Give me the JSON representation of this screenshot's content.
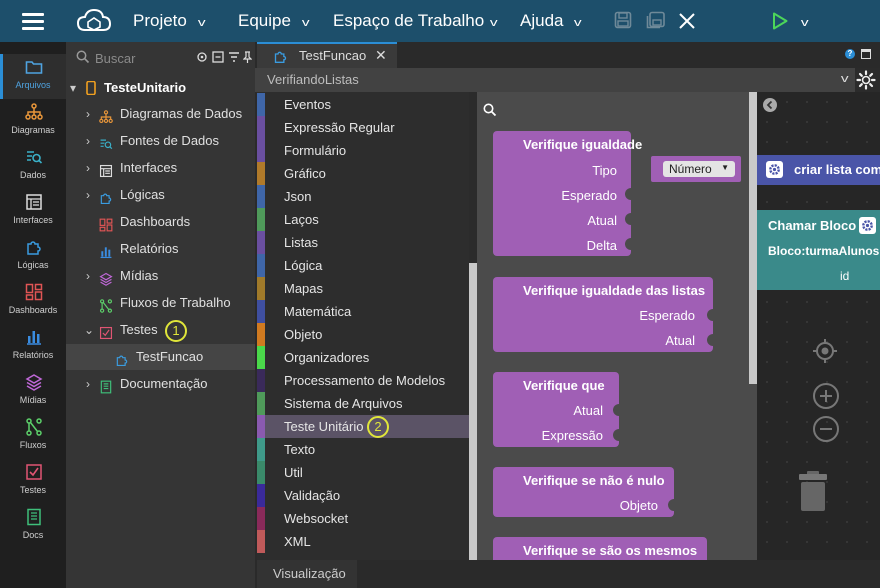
{
  "topbar": {
    "menus": [
      "Projeto",
      "Equipe",
      "Espaço de Trabalho",
      "Ajuda"
    ]
  },
  "rail": [
    {
      "label": "Arquivos",
      "icon": "folder-icon",
      "color": "#4fa3e0",
      "active": true
    },
    {
      "label": "Diagramas",
      "icon": "diagram-icon",
      "color": "#e8963a"
    },
    {
      "label": "Dados",
      "icon": "data-icon",
      "color": "#3ab0c8"
    },
    {
      "label": "Interfaces",
      "icon": "interface-icon",
      "color": "#dddddd"
    },
    {
      "label": "Lógicas",
      "icon": "puzzle-icon",
      "color": "#3a9ce0"
    },
    {
      "label": "Dashboards",
      "icon": "dashboard-icon",
      "color": "#e05555"
    },
    {
      "label": "Relatórios",
      "icon": "bar-chart-icon",
      "color": "#3a8ce0"
    },
    {
      "label": "Mídias",
      "icon": "layers-icon",
      "color": "#c068d8"
    },
    {
      "label": "Fluxos",
      "icon": "flow-icon",
      "color": "#5ccf6a"
    },
    {
      "label": "Testes",
      "icon": "test-icon",
      "color": "#e05573"
    },
    {
      "label": "Docs",
      "icon": "book-icon",
      "color": "#3fbf7a"
    }
  ],
  "tree": {
    "search_placeholder": "Buscar",
    "root": "TesteUnitario",
    "items": [
      {
        "label": "Diagramas de Dados",
        "icon": "diagram-icon",
        "color": "#e8963a"
      },
      {
        "label": "Fontes de Dados",
        "icon": "data-icon",
        "color": "#3ab0c8"
      },
      {
        "label": "Interfaces",
        "icon": "interface-icon",
        "color": "#dddddd"
      },
      {
        "label": "Lógicas",
        "icon": "puzzle-icon",
        "color": "#3a9ce0"
      },
      {
        "label": "Dashboards",
        "icon": "dashboard-icon",
        "color": "#e05555"
      },
      {
        "label": "Relatórios",
        "icon": "bar-chart-icon",
        "color": "#3a8ce0"
      },
      {
        "label": "Mídias",
        "icon": "layers-icon",
        "color": "#c068d8"
      },
      {
        "label": "Fluxos de Trabalho",
        "icon": "flow-icon",
        "color": "#5ccf6a"
      },
      {
        "label": "Testes",
        "icon": "test-icon",
        "color": "#e05573",
        "badge": "1"
      },
      {
        "label": "TestFuncao",
        "icon": "puzzle-icon",
        "color": "#3a9ce0"
      },
      {
        "label": "Documentação",
        "icon": "book-icon",
        "color": "#3fbf7a"
      }
    ]
  },
  "editor": {
    "tab": "TestFuncao",
    "path": "VerifiandoListas",
    "bottom_tab": "Visualização"
  },
  "categories": [
    {
      "label": "Eventos",
      "color": "#3f66a8"
    },
    {
      "label": "Expressão Regular",
      "color": "#6a4fa0"
    },
    {
      "label": "Formulário",
      "color": "#6a4fa0"
    },
    {
      "label": "Gráfico",
      "color": "#b07a2a"
    },
    {
      "label": "Json",
      "color": "#3f66a8"
    },
    {
      "label": "Laços",
      "color": "#4f9a5a"
    },
    {
      "label": "Listas",
      "color": "#6a4fa0"
    },
    {
      "label": "Lógica",
      "color": "#3f66a8"
    },
    {
      "label": "Mapas",
      "color": "#a07a2a"
    },
    {
      "label": "Matemática",
      "color": "#3f4fa0"
    },
    {
      "label": "Objeto",
      "color": "#d07a20"
    },
    {
      "label": "Organizadores",
      "color": "#4ad84a"
    },
    {
      "label": "Processamento de Modelos",
      "color": "#3a2a5a"
    },
    {
      "label": "Sistema de Arquivos",
      "color": "#4f9a5a"
    },
    {
      "label": "Teste Unitário",
      "color": "#8a5ab0",
      "badge": "2"
    },
    {
      "label": "Texto",
      "color": "#3f9a8a"
    },
    {
      "label": "Util",
      "color": "#3a8a6a"
    },
    {
      "label": "Validação",
      "color": "#3a2a9a"
    },
    {
      "label": "Websocket",
      "color": "#8a2a5a"
    },
    {
      "label": "XML",
      "color": "#c05a5a"
    }
  ],
  "blocks": [
    {
      "title": "Verifique igualdade",
      "inputs": [
        "Tipo",
        "Esperado",
        "Atual",
        "Delta"
      ],
      "dropdown": "Número"
    },
    {
      "title": "Verifique igualdade das listas",
      "inputs": [
        "Esperado",
        "Atual"
      ]
    },
    {
      "title": "Verifique que",
      "inputs": [
        "Atual",
        "Expressão"
      ]
    },
    {
      "title": "Verifique se não é nulo",
      "inputs": [
        "Objeto"
      ]
    },
    {
      "title": "Verifique se são os mesmos",
      "inputs": []
    }
  ],
  "workspace": {
    "block1": "criar lista com",
    "block2_title": "Chamar Bloco",
    "block2_sub": "Bloco:turmaAlunos",
    "block2_param": "id"
  }
}
